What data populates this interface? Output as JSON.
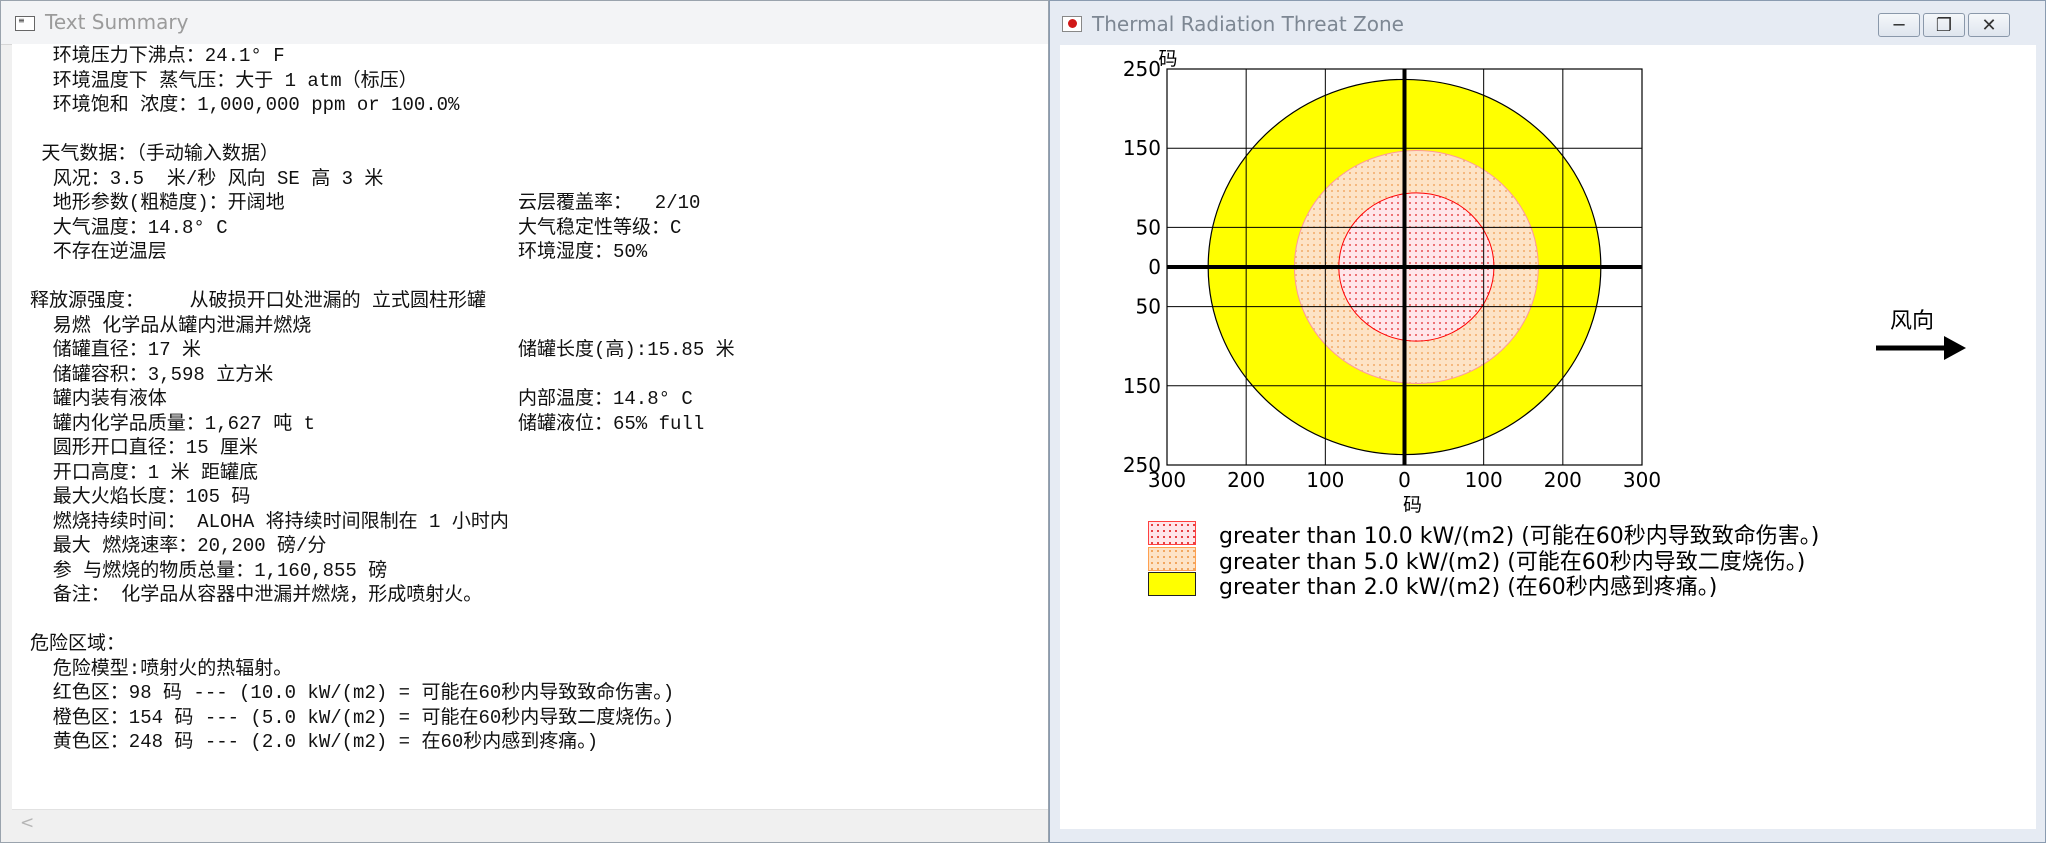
{
  "text_summary": {
    "title": "Text Summary",
    "lines": [
      {
        "text": "  环境压力下沸点：24.1° F",
        "indent": 0
      },
      {
        "text": "  环境温度下 蒸气压：大于 1 atm（标压）",
        "indent": 0
      },
      {
        "text": "  环境饱和 浓度：1,000,000 ppm or 100.0%",
        "indent": 0
      },
      {
        "text": "",
        "indent": 0
      },
      {
        "text": " 天气数据：（手动输入数据）",
        "indent": 0
      },
      {
        "text": "  风况：3.5  米/秒 风向 SE 高 3 米",
        "indent": 0
      },
      {
        "text": "  地形参数(粗糙度)：开阔地",
        "right": "云层覆盖率：  2/10"
      },
      {
        "text": "  大气温度：14.8° C",
        "right": "大气稳定性等级：C"
      },
      {
        "text": "  不存在逆温层",
        "right": "环境湿度：50%"
      },
      {
        "text": "",
        "indent": 0
      },
      {
        "text": "释放源强度：    从破损开口处泄漏的 立式圆柱形罐",
        "indent": 0
      },
      {
        "text": "  易燃 化学品从罐内泄漏并燃烧",
        "indent": 0
      },
      {
        "text": "  储罐直径：17 米",
        "right": "储罐长度(高):15.85 米"
      },
      {
        "text": "  储罐容积：3,598 立方米",
        "indent": 0
      },
      {
        "text": "  罐内装有液体",
        "right": "内部温度：14.8° C"
      },
      {
        "text": "  罐内化学品质量：1,627 吨 t",
        "right": "储罐液位：65% full"
      },
      {
        "text": "  圆形开口直径：15 厘米",
        "indent": 0
      },
      {
        "text": "  开口高度：1 米 距罐底",
        "indent": 0
      },
      {
        "text": "  最大火焰长度：105 码",
        "indent": 0
      },
      {
        "text": "  燃烧持续时间： ALOHA 将持续时间限制在 1 小时内",
        "indent": 0
      },
      {
        "text": "  最大 燃烧速率：20,200 磅/分",
        "indent": 0
      },
      {
        "text": "  参 与燃烧的物质总量：1,160,855 磅",
        "indent": 0
      },
      {
        "text": "  备注： 化学品从容器中泄漏并燃烧，形成喷射火。",
        "indent": 0
      },
      {
        "text": "",
        "indent": 0
      },
      {
        "text": "危险区域：",
        "indent": 0
      },
      {
        "text": "  危险模型:喷射火的热辐射。",
        "indent": 0
      },
      {
        "text": "  红色区：98 码 --- (10.0 kW/(m2) = 可能在60秒内导致致命伤害。)",
        "indent": 0
      },
      {
        "text": "  橙色区：154 码 --- (5.0 kW/(m2) = 可能在60秒内导致二度烧伤。)",
        "indent": 0
      },
      {
        "text": "  黄色区：248 码 --- (2.0 kW/(m2) = 在60秒内感到疼痛。)",
        "indent": 0
      }
    ],
    "scroll_left_icon": "chevron-left-icon"
  },
  "threat_zone": {
    "title": "Thermal Radiation Threat Zone",
    "app_icon": "aloha-app-icon",
    "buttons": {
      "minimize": "─",
      "maximize": "❐",
      "close": "✕"
    },
    "wind_label": "风向",
    "legend": [
      {
        "label": "greater than 10.0 kW/(m2) (可能在60秒内导致致命伤害。)",
        "color": "#ff0000",
        "fill": "#ffe6ea",
        "pattern": "dots-red"
      },
      {
        "label": "greater than 5.0 kW/(m2) (可能在60秒内导致二度烧伤。)",
        "color": "#ff9933",
        "fill": "#fde3c6",
        "pattern": "dots-orange"
      },
      {
        "label": "greater than 2.0 kW/(m2) (在60秒内感到疼痛。)",
        "color": "#ffff00",
        "fill": "#ffff00",
        "pattern": "solid"
      }
    ]
  },
  "chart_data": {
    "type": "threat-zone-plot",
    "xlabel": "码",
    "ylabel": "码",
    "x_ticks": [
      "300",
      "200",
      "100",
      "0",
      "100",
      "200",
      "300"
    ],
    "x_tick_values": [
      -300,
      -200,
      -100,
      0,
      100,
      200,
      300
    ],
    "y_ticks": [
      "250",
      "150",
      "50",
      "0",
      "50",
      "150",
      "250"
    ],
    "y_tick_values": [
      250,
      150,
      50,
      0,
      -50,
      -150,
      -250
    ],
    "xlim": [
      -300,
      300
    ],
    "ylim": [
      -250,
      250
    ],
    "grid": true,
    "zones": [
      {
        "name": "yellow",
        "radius": 248,
        "center_x": 0,
        "color": "#ffff00"
      },
      {
        "name": "orange",
        "radius": 154,
        "center_x": 15,
        "color": "#ff9933"
      },
      {
        "name": "red",
        "radius": 98,
        "center_x": 15,
        "color": "#ff0000"
      }
    ],
    "wind_direction": "right"
  }
}
